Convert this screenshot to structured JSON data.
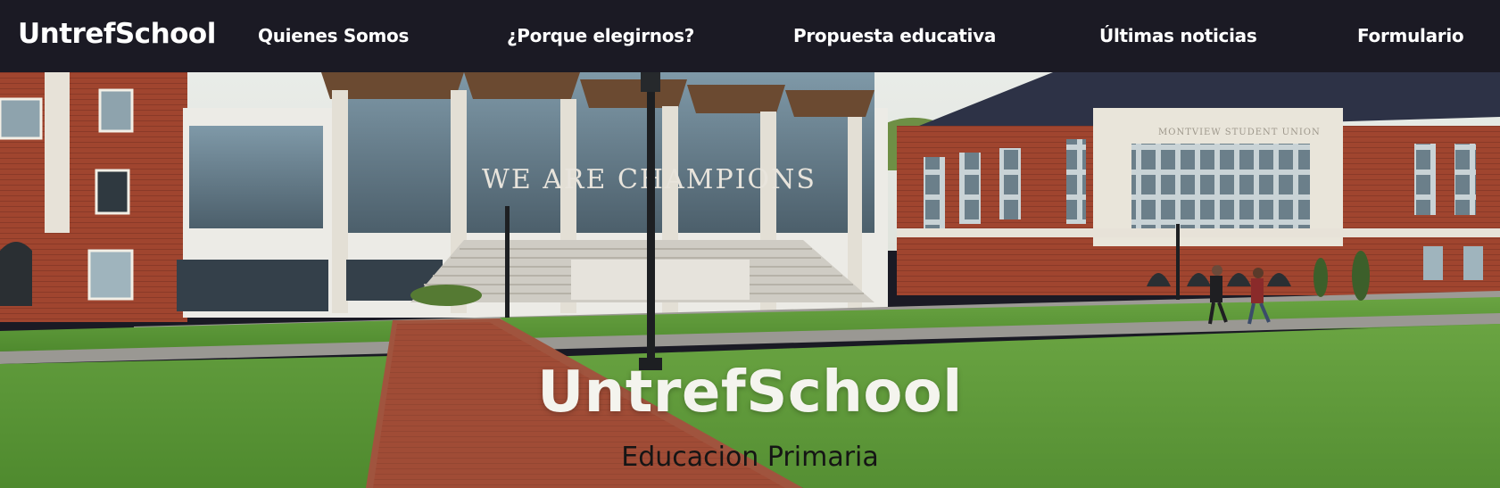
{
  "nav": {
    "brand": "UntrefSchool",
    "links": [
      {
        "label": "Quienes Somos"
      },
      {
        "label": "¿Porque elegirnos?"
      },
      {
        "label": "Propuesta educativa"
      },
      {
        "label": "Últimas noticias"
      },
      {
        "label": "Formulario"
      }
    ]
  },
  "hero": {
    "title": "UntrefSchool",
    "subtitle": "Educacion Primaria",
    "photo": {
      "facade_sign": "WE ARE CHAMPIONS",
      "building_sign": "MONTVIEW STUDENT UNION"
    }
  },
  "colors": {
    "navbar_bg": "#1b1a24",
    "nav_text": "#ffffff",
    "hero_title": "#f4f4ee",
    "hero_subtitle": "#151515"
  }
}
